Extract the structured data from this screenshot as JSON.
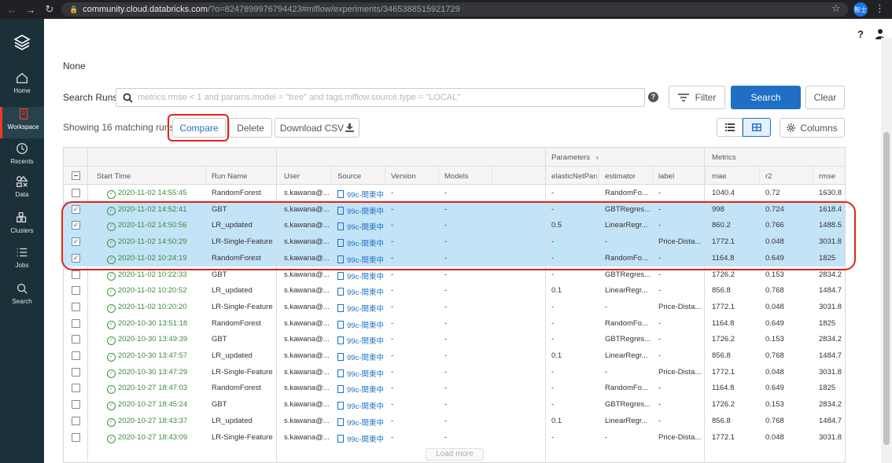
{
  "browser": {
    "url_host": "community.cloud.databricks.com",
    "url_rest": "/?o=8247899976794423#mlflow/experiments/3465388515921729",
    "profile_label": "智士"
  },
  "sidebar": {
    "items": [
      {
        "label": "Home",
        "icon": "home-icon"
      },
      {
        "label": "Workspace",
        "icon": "workspace-icon"
      },
      {
        "label": "Recents",
        "icon": "clock-icon"
      },
      {
        "label": "Data",
        "icon": "data-icon"
      },
      {
        "label": "Clusters",
        "icon": "clusters-icon"
      },
      {
        "label": "Jobs",
        "icon": "jobs-icon"
      },
      {
        "label": "Search",
        "icon": "search-icon"
      }
    ]
  },
  "description": "None",
  "search": {
    "label": "Search Runs:",
    "placeholder": "metrics.rmse < 1 and params.model = \"tree\" and tags.mlflow.source.type = \"LOCAL\"",
    "help": "?",
    "filter_label": "Filter",
    "search_label": "Search",
    "clear_label": "Clear"
  },
  "actions": {
    "showing": "Showing 16 matching runs",
    "compare": "Compare",
    "delete": "Delete",
    "download": "Download CSV",
    "columns": "Columns"
  },
  "table": {
    "groups": {
      "parameters": "Parameters",
      "parameters_arrow": "›",
      "metrics": "Metrics"
    },
    "columns": [
      "Start Time",
      "Run Name",
      "User",
      "Source",
      "Version",
      "Models",
      "elasticNetParam",
      "estimator",
      "label",
      "mae",
      "r2",
      "rmse"
    ],
    "rows": [
      {
        "checked": false,
        "start": "2020-11-02 14:55:45",
        "name": "RandomForest",
        "user": "s.kawana@...",
        "source": "99c-関東中",
        "version": "-",
        "models": "-",
        "enp": "-",
        "estimator": "RandomFo...",
        "label": "-",
        "mae": "1040.4",
        "r2": "0.72",
        "rmse": "1630.8"
      },
      {
        "checked": true,
        "start": "2020-11-02 14:52:41",
        "name": "GBT",
        "user": "s.kawana@...",
        "source": "99c-関東中",
        "version": "-",
        "models": "-",
        "enp": "-",
        "estimator": "GBTRegres...",
        "label": "-",
        "mae": "998",
        "r2": "0.724",
        "rmse": "1618.4"
      },
      {
        "checked": true,
        "start": "2020-11-02 14:50:56",
        "name": "LR_updated",
        "user": "s.kawana@...",
        "source": "99c-関東中",
        "version": "-",
        "models": "-",
        "enp": "0.5",
        "estimator": "LinearRegr...",
        "label": "-",
        "mae": "860.2",
        "r2": "0.766",
        "rmse": "1488.5"
      },
      {
        "checked": true,
        "start": "2020-11-02 14:50:29",
        "name": "LR-Single-Feature",
        "user": "s.kawana@...",
        "source": "99c-関東中",
        "version": "-",
        "models": "-",
        "enp": "-",
        "estimator": "-",
        "label": "Price-Dista...",
        "mae": "1772.1",
        "r2": "0.048",
        "rmse": "3031.8"
      },
      {
        "checked": true,
        "start": "2020-11-02 10:24:19",
        "name": "RandomForest",
        "user": "s.kawana@...",
        "source": "99c-関東中",
        "version": "-",
        "models": "-",
        "enp": "-",
        "estimator": "RandomFo...",
        "label": "-",
        "mae": "1164.8",
        "r2": "0.649",
        "rmse": "1825"
      },
      {
        "checked": false,
        "start": "2020-11-02 10:22:33",
        "name": "GBT",
        "user": "s.kawana@...",
        "source": "99c-関東中",
        "version": "-",
        "models": "-",
        "enp": "-",
        "estimator": "GBTRegres...",
        "label": "-",
        "mae": "1726.2",
        "r2": "0.153",
        "rmse": "2834.2"
      },
      {
        "checked": false,
        "start": "2020-11-02 10:20:52",
        "name": "LR_updated",
        "user": "s.kawana@...",
        "source": "99c-関東中",
        "version": "-",
        "models": "-",
        "enp": "0.1",
        "estimator": "LinearRegr...",
        "label": "-",
        "mae": "856.8",
        "r2": "0.768",
        "rmse": "1484.7"
      },
      {
        "checked": false,
        "start": "2020-11-02 10:20:20",
        "name": "LR-Single-Feature",
        "user": "s.kawana@...",
        "source": "99c-関東中",
        "version": "-",
        "models": "-",
        "enp": "-",
        "estimator": "-",
        "label": "Price-Dista...",
        "mae": "1772.1",
        "r2": "0.048",
        "rmse": "3031.8"
      },
      {
        "checked": false,
        "start": "2020-10-30 13:51:18",
        "name": "RandomForest",
        "user": "s.kawana@...",
        "source": "99c-関東中",
        "version": "-",
        "models": "-",
        "enp": "-",
        "estimator": "RandomFo...",
        "label": "-",
        "mae": "1164.8",
        "r2": "0.649",
        "rmse": "1825"
      },
      {
        "checked": false,
        "start": "2020-10-30 13:49:39",
        "name": "GBT",
        "user": "s.kawana@...",
        "source": "99c-関東中",
        "version": "-",
        "models": "-",
        "enp": "-",
        "estimator": "GBTRegres...",
        "label": "-",
        "mae": "1726.2",
        "r2": "0.153",
        "rmse": "2834.2"
      },
      {
        "checked": false,
        "start": "2020-10-30 13:47:57",
        "name": "LR_updated",
        "user": "s.kawana@...",
        "source": "99c-関東中",
        "version": "-",
        "models": "-",
        "enp": "0.1",
        "estimator": "LinearRegr...",
        "label": "-",
        "mae": "856.8",
        "r2": "0.768",
        "rmse": "1484.7"
      },
      {
        "checked": false,
        "start": "2020-10-30 13:47:29",
        "name": "LR-Single-Feature",
        "user": "s.kawana@...",
        "source": "99c-関東中",
        "version": "-",
        "models": "-",
        "enp": "-",
        "estimator": "-",
        "label": "Price-Dista...",
        "mae": "1772.1",
        "r2": "0.048",
        "rmse": "3031.8"
      },
      {
        "checked": false,
        "start": "2020-10-27 18:47:03",
        "name": "RandomForest",
        "user": "s.kawana@...",
        "source": "99c-関東中",
        "version": "-",
        "models": "-",
        "enp": "-",
        "estimator": "RandomFo...",
        "label": "-",
        "mae": "1164.8",
        "r2": "0.649",
        "rmse": "1825"
      },
      {
        "checked": false,
        "start": "2020-10-27 18:45:24",
        "name": "GBT",
        "user": "s.kawana@...",
        "source": "99c-関東中",
        "version": "-",
        "models": "-",
        "enp": "-",
        "estimator": "GBTRegres...",
        "label": "-",
        "mae": "1726.2",
        "r2": "0.153",
        "rmse": "2834.2"
      },
      {
        "checked": false,
        "start": "2020-10-27 18:43:37",
        "name": "LR_updated",
        "user": "s.kawana@...",
        "source": "99c-関東中",
        "version": "-",
        "models": "-",
        "enp": "0.1",
        "estimator": "LinearRegr...",
        "label": "-",
        "mae": "856.8",
        "r2": "0.768",
        "rmse": "1484.7"
      },
      {
        "checked": false,
        "start": "2020-10-27 18:43:09",
        "name": "LR-Single-Feature",
        "user": "s.kawana@...",
        "source": "99c-関東中",
        "version": "-",
        "models": "-",
        "enp": "-",
        "estimator": "-",
        "label": "Price-Dista...",
        "mae": "1772.1",
        "r2": "0.048",
        "rmse": "3031.8"
      }
    ],
    "load_more": "Load more"
  },
  "colors": {
    "sidebar_bg": "#1b3139",
    "accent_blue": "#1f6fc5",
    "selected_row": "#c3e3f7",
    "highlight_red": "#e2231a",
    "success_green": "#3a8c3a"
  }
}
